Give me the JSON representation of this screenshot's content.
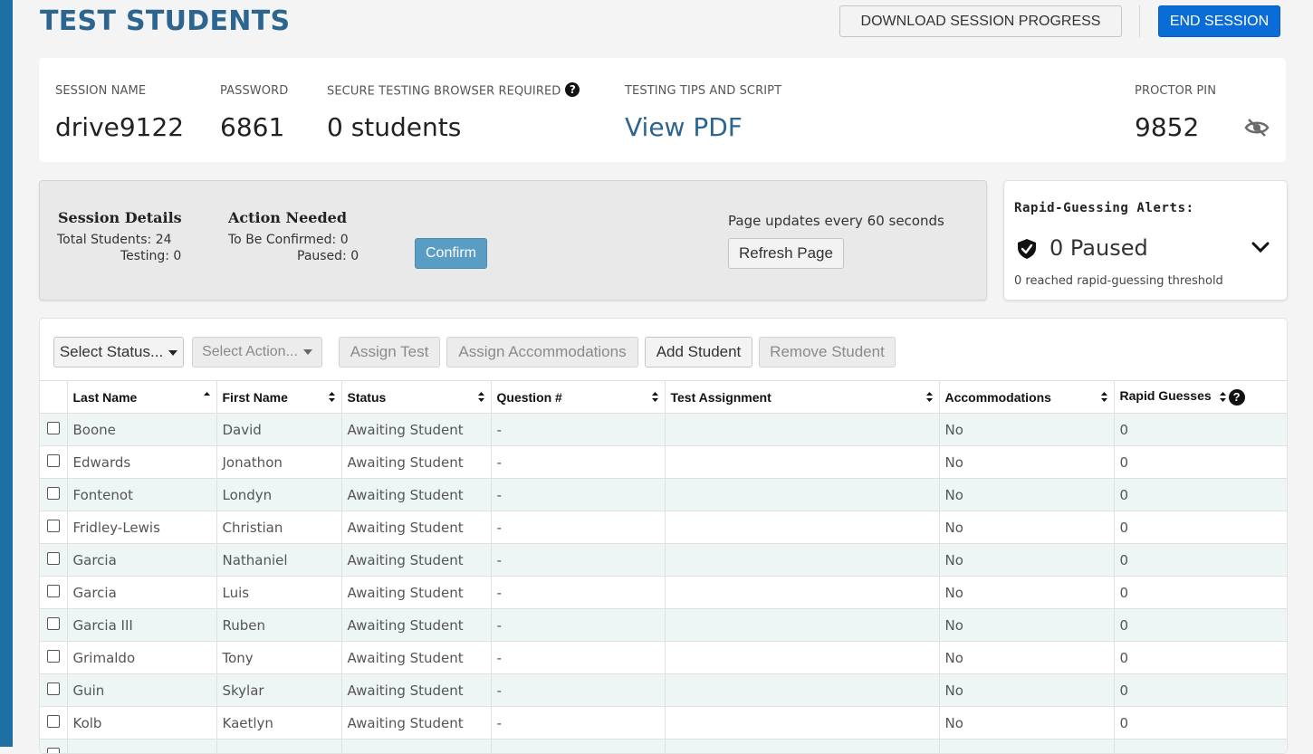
{
  "header": {
    "title": "TEST STUDENTS",
    "download_label": "DOWNLOAD SESSION PROGRESS",
    "end_label": "END SESSION"
  },
  "session_info": {
    "session_name_label": "SESSION NAME",
    "session_name": "drive9122",
    "password_label": "PASSWORD",
    "password": "6861",
    "secure_browser_label": "SECURE TESTING BROWSER REQUIRED",
    "secure_browser_value": "0 students",
    "tips_label": "TESTING TIPS AND SCRIPT",
    "tips_link": "View PDF",
    "proctor_pin_label": "PROCTOR PIN",
    "proctor_pin": "9852"
  },
  "status_panel": {
    "session_details_heading": "Session Details",
    "total_students": "Total Students: 24",
    "testing": "Testing: 0",
    "action_needed_heading": "Action Needed",
    "to_be_confirmed": "To Be Confirmed: 0",
    "paused": "Paused: 0",
    "confirm_label": "Confirm",
    "update_note": "Page updates every 60 seconds",
    "refresh_label": "Refresh Page"
  },
  "alerts": {
    "title": "Rapid-Guessing Alerts:",
    "paused_text": "0 Paused",
    "threshold_text": "0 reached rapid-guessing threshold"
  },
  "toolbar": {
    "select_status": "Select Status...",
    "select_action": "Select Action...",
    "assign_test": "Assign Test",
    "assign_accommodations": "Assign Accommodations",
    "add_student": "Add Student",
    "remove_student": "Remove Student"
  },
  "table": {
    "columns": [
      "Last Name",
      "First Name",
      "Status",
      "Question #",
      "Test Assignment",
      "Accommodations",
      "Rapid Guesses"
    ],
    "rows": [
      {
        "last": "Boone",
        "first": "David",
        "status": "Awaiting Student",
        "question": "-",
        "test": "",
        "accom": "No",
        "rapid": "0"
      },
      {
        "last": "Edwards",
        "first": "Jonathon",
        "status": "Awaiting Student",
        "question": "-",
        "test": "",
        "accom": "No",
        "rapid": "0"
      },
      {
        "last": "Fontenot",
        "first": "Londyn",
        "status": "Awaiting Student",
        "question": "-",
        "test": "",
        "accom": "No",
        "rapid": "0"
      },
      {
        "last": "Fridley-Lewis",
        "first": "Christian",
        "status": "Awaiting Student",
        "question": "-",
        "test": "",
        "accom": "No",
        "rapid": "0"
      },
      {
        "last": "Garcia",
        "first": "Nathaniel",
        "status": "Awaiting Student",
        "question": "-",
        "test": "",
        "accom": "No",
        "rapid": "0"
      },
      {
        "last": "Garcia",
        "first": "Luis",
        "status": "Awaiting Student",
        "question": "-",
        "test": "",
        "accom": "No",
        "rapid": "0"
      },
      {
        "last": "Garcia III",
        "first": "Ruben",
        "status": "Awaiting Student",
        "question": "-",
        "test": "",
        "accom": "No",
        "rapid": "0"
      },
      {
        "last": "Grimaldo",
        "first": "Tony",
        "status": "Awaiting Student",
        "question": "-",
        "test": "",
        "accom": "No",
        "rapid": "0"
      },
      {
        "last": "Guin",
        "first": "Skylar",
        "status": "Awaiting Student",
        "question": "-",
        "test": "",
        "accom": "No",
        "rapid": "0"
      },
      {
        "last": "Kolb",
        "first": "Kaetlyn",
        "status": "Awaiting Student",
        "question": "-",
        "test": "",
        "accom": "No",
        "rapid": "0"
      },
      {
        "last": "",
        "first": "",
        "status": "",
        "question": "",
        "test": "",
        "accom": "",
        "rapid": ""
      }
    ]
  },
  "colors": {
    "title_blue": "#2c6690",
    "end_button": "#0a6cd6",
    "confirm_button": "#5a9dc4",
    "left_strip": "#1d6fa4"
  },
  "icons": [
    "help-icon",
    "eye-off-icon",
    "shield-check-icon",
    "chevron-down-icon",
    "sort-icon",
    "caret-down-icon"
  ]
}
